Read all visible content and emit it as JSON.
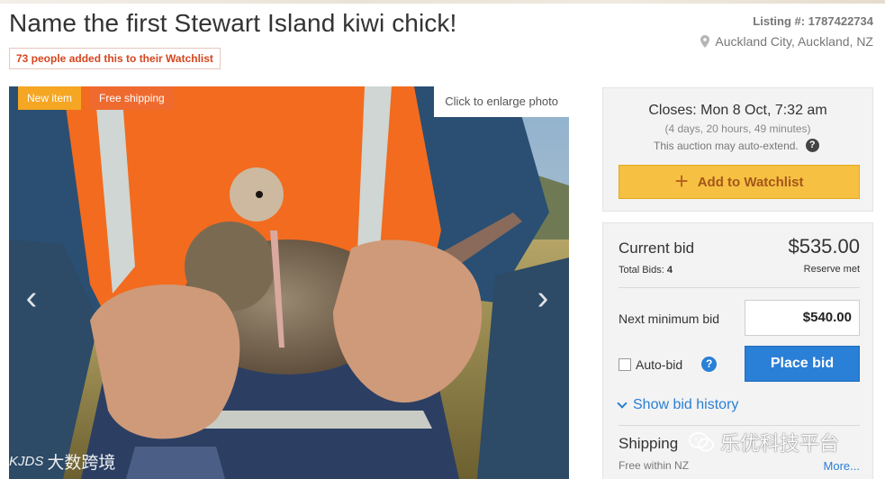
{
  "listing": {
    "title": "Name the first Stewart Island kiwi chick!",
    "watchlist_count": "73 people added this to their Watchlist",
    "listing_number": "Listing #: 1787422734",
    "location": "Auckland City, Auckland, NZ"
  },
  "photo": {
    "badge_new": "New item",
    "badge_shipping": "Free shipping",
    "enlarge_label": "Click to enlarge photo",
    "prev_arrow": "‹",
    "next_arrow": "›",
    "watermark": "大数跨境",
    "watermark_logo": "KJDS"
  },
  "auction": {
    "closes": "Closes: Mon 8 Oct, 7:32 am",
    "remaining": "(4 days, 20 hours, 49 minutes)",
    "auto_extend": "This auction may auto-extend.",
    "help_mark": "?",
    "add_watchlist_label": "Add to Watchlist",
    "plus": "+"
  },
  "bidding": {
    "current_bid_label": "Current bid",
    "current_bid_value": "$535.00",
    "total_bids_label": "Total Bids:",
    "total_bids_value": "4",
    "reserve_status": "Reserve met",
    "next_min_label": "Next minimum bid",
    "next_min_value": "$540.00",
    "auto_bid_label": "Auto-bid",
    "help_mark": "?",
    "place_bid_label": "Place bid",
    "show_history_label": "Show bid history"
  },
  "shipping": {
    "label": "Shipping",
    "free_within": "Free within NZ",
    "more_link": "More..."
  },
  "watermark_right": "乐优科技平台",
  "colors": {
    "accent_orange": "#d5461f",
    "watchlist_yellow": "#f6c142",
    "primary_blue": "#2a7fd6",
    "badge_new": "#f5a623",
    "badge_shipping": "#ef6a2f"
  }
}
